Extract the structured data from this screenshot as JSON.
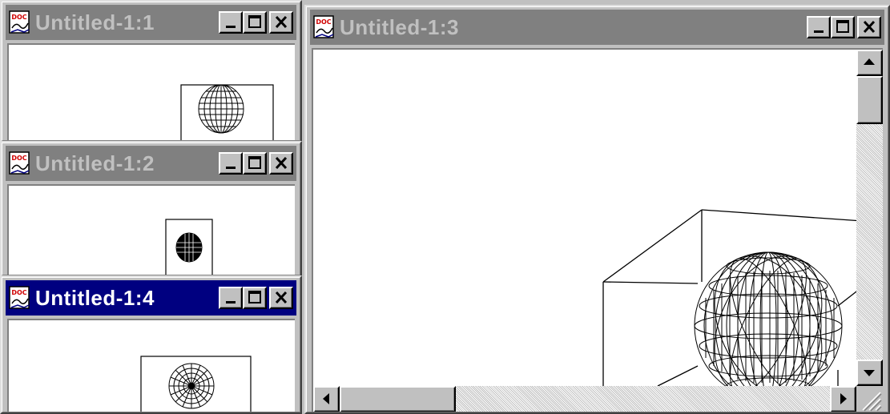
{
  "windows": [
    {
      "title": "Untitled-1:1",
      "active": false
    },
    {
      "title": "Untitled-1:2",
      "active": false
    },
    {
      "title": "Untitled-1:4",
      "active": true
    },
    {
      "title": "Untitled-1:3",
      "active": false
    }
  ],
  "icons": {
    "document": "doc-icon",
    "minimize": "minimize-icon",
    "maximize": "maximize-icon",
    "close": "close-icon"
  },
  "doc_icon_text": "DOC",
  "colors": {
    "active_title": "#000080",
    "inactive_title": "#808080",
    "face": "#c0c0c0",
    "client": "#ffffff"
  }
}
